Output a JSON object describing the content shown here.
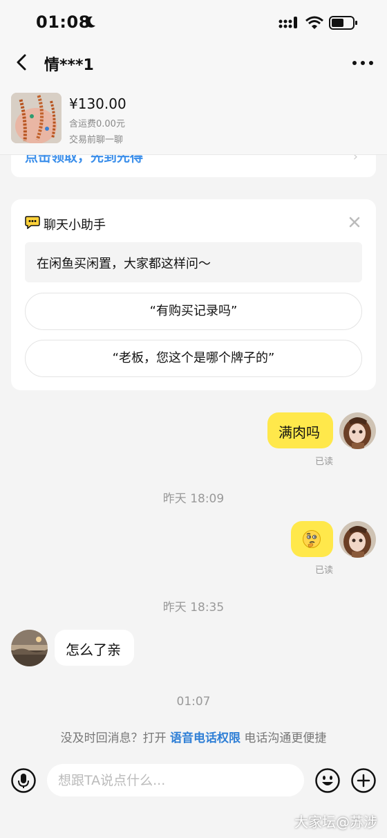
{
  "status_bar": {
    "time": "01:08"
  },
  "header": {
    "title": "情***1"
  },
  "product": {
    "price": "¥130.00",
    "shipping": "含运费0.00元",
    "chat_first": "交易前聊一聊"
  },
  "promo": {
    "text": "点击领取，先到先得"
  },
  "assistant": {
    "title": "聊天小助手",
    "note": "在闲鱼买闲置，大家都这样问～",
    "suggestions": [
      "“有购买记录吗”",
      "“老板，您这个是哪个牌子的”"
    ]
  },
  "messages": {
    "m1": {
      "text": "满肉吗",
      "read": "已读"
    },
    "t1": "昨天 18:09",
    "m2": {
      "read": "已读"
    },
    "t2": "昨天 18:35",
    "m3": {
      "text": "怎么了亲"
    },
    "t3": "01:07"
  },
  "hint": {
    "prefix": "没及时回消息？打开 ",
    "link": "语音电话权限",
    "suffix": " 电话沟通更便捷"
  },
  "input": {
    "placeholder": "想跟TA说点什么..."
  },
  "watermark": "大家坛@苏涉",
  "colors": {
    "bubble_self": "#ffe84b",
    "link": "#2f7fd6",
    "background": "#f4f4f4"
  }
}
